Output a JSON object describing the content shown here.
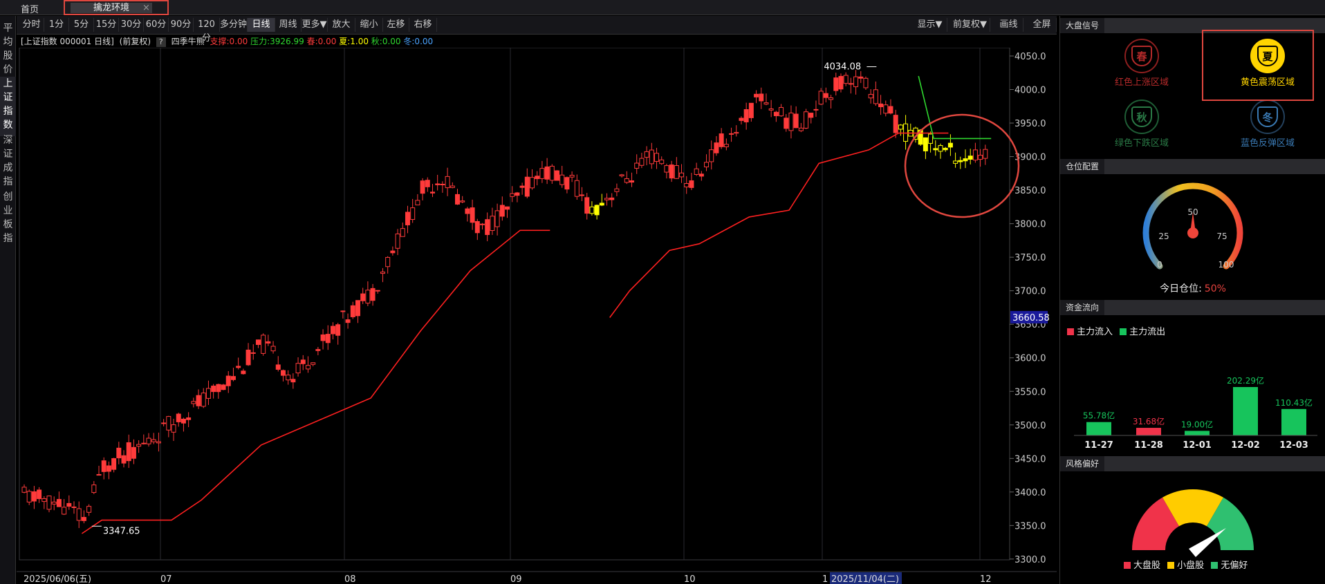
{
  "top": {
    "home_label": "首页",
    "active_tab_label": "擒龙环境",
    "close_glyph": "×"
  },
  "sidebar": {
    "items": [
      "平均股价",
      "上证指数",
      "深证成指",
      "创业板指"
    ],
    "active_index": 1
  },
  "toolbar": {
    "left_buttons": [
      "分时",
      "1分",
      "5分",
      "15分",
      "30分",
      "60分",
      "90分",
      "120分",
      "多分钟",
      "日线",
      "周线",
      "更多▼",
      "放大",
      "缩小",
      "左移",
      "右移"
    ],
    "active_button": "日线",
    "right_buttons": [
      "显示▼",
      "前复权▼",
      "画线",
      "全屏"
    ]
  },
  "info": {
    "index_label": "[上证指数 000001 日线]",
    "adjust_label": "(前复权)",
    "help_glyph": "?",
    "indicator_name": "四季牛熊",
    "support": "支撑:0.00",
    "resistance": "压力:3926.99",
    "spring": "春:0.00",
    "summer": "夏:1.00",
    "autumn": "秋:0.00",
    "winter": "冬:0.00",
    "colors": {
      "support": "#ff3b3b",
      "resistance": "#2fd82f",
      "spring": "#ff3b3b",
      "summer": "#ffff00",
      "autumn": "#2fd82f",
      "winter": "#4aa3ff"
    }
  },
  "chart_data": {
    "type": "candlestick",
    "ylim": [
      3300,
      4050
    ],
    "y_ticks": [
      "4050.0",
      "4000.0",
      "3950.0",
      "3900.0",
      "3850.0",
      "3800.0",
      "3750.0",
      "3700.0",
      "3650.0",
      "3600.0",
      "3550.0",
      "3500.0",
      "3450.0",
      "3400.0",
      "3350.0",
      "3300.0"
    ],
    "current_price_label": "3660.58",
    "x_labels": [
      "2025/06/06(五)",
      "07",
      "08",
      "09",
      "10",
      "1",
      "2025/11/04(二)",
      "12"
    ],
    "max_annotation": "4034.08",
    "min_annotation": "3347.65",
    "colors": {
      "up": "#ff3b3b",
      "down": "#ff3b3b",
      "bear_season": "#ffff00",
      "support_line": "#ff2020",
      "resistance_line": "#2fd82f",
      "grid": "#2a2a30",
      "highlight_circle": "#e0473f"
    }
  },
  "signals": {
    "header": "大盘信号",
    "items": [
      {
        "glyph": "春",
        "label": "红色上涨区域",
        "color": "#8e1f1f",
        "text_color": "#b52a2a",
        "active": false
      },
      {
        "glyph": "夏",
        "label": "黄色震荡区域",
        "color": "#ffd400",
        "text_color": "#ffd400",
        "active": true
      },
      {
        "glyph": "秋",
        "label": "绿色下跌区域",
        "color": "#1f5e36",
        "text_color": "#2a7a46",
        "active": false
      },
      {
        "glyph": "冬",
        "label": "蓝色反弹区域",
        "color": "#23405c",
        "text_color": "#3a7ab4",
        "active": false
      }
    ]
  },
  "position": {
    "header": "仓位配置",
    "gauge_ticks": [
      "0",
      "25",
      "50",
      "75",
      "100"
    ],
    "label": "今日仓位:",
    "value_text": "50%",
    "value": 50
  },
  "fund_flow": {
    "header": "资金流向",
    "legend": [
      "主力流入",
      "主力流出"
    ],
    "legend_colors": [
      "#f0334a",
      "#17c45c"
    ],
    "dates": [
      "11-27",
      "11-28",
      "12-01",
      "12-02",
      "12-03"
    ],
    "value_labels": [
      "55.78亿",
      "31.68亿",
      "19.00亿",
      "202.29亿",
      "110.43亿"
    ],
    "values": [
      55.78,
      31.68,
      19.0,
      202.29,
      110.43
    ],
    "directions": [
      "out",
      "in",
      "out",
      "out",
      "out"
    ]
  },
  "style": {
    "header": "风格偏好",
    "legend": [
      "大盘股",
      "小盘股",
      "无偏好"
    ],
    "legend_colors": [
      "#f0334a",
      "#ffcc00",
      "#2fc070"
    ]
  }
}
